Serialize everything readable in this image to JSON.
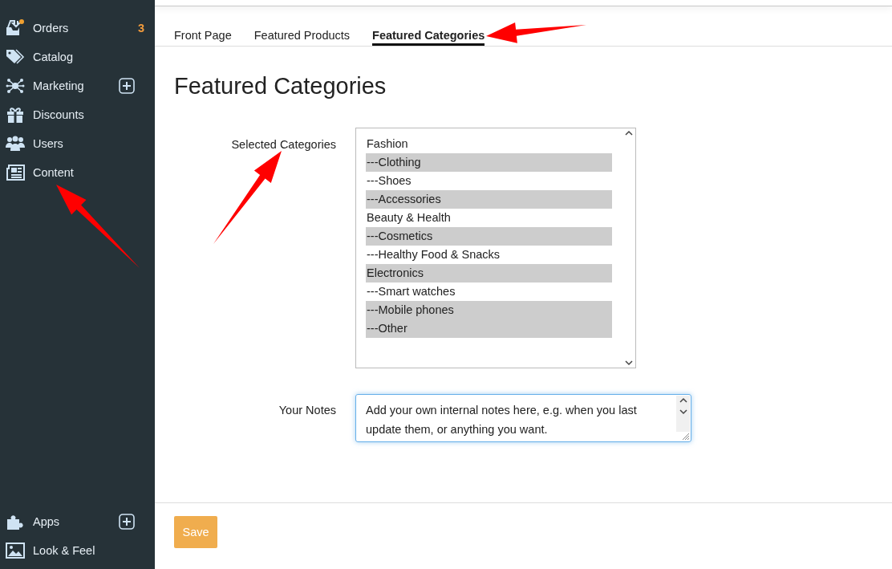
{
  "sidebar": {
    "items": [
      {
        "label": "Orders",
        "badge": "3",
        "add_button": false
      },
      {
        "label": "Catalog",
        "add_button": false
      },
      {
        "label": "Marketing",
        "add_button": true
      },
      {
        "label": "Discounts",
        "add_button": false
      },
      {
        "label": "Users",
        "add_button": false
      },
      {
        "label": "Content",
        "add_button": false
      }
    ],
    "bottom_items": [
      {
        "label": "Apps",
        "add_button": true
      },
      {
        "label": "Look & Feel",
        "add_button": false
      }
    ]
  },
  "tabs": [
    {
      "label": "Front Page",
      "selected": false
    },
    {
      "label": "Featured Products",
      "selected": false
    },
    {
      "label": "Featured Categories",
      "selected": true
    }
  ],
  "heading": "Featured Categories",
  "categories_field": {
    "label": "Selected Categories",
    "options": [
      {
        "label": "Fashion",
        "selected": false
      },
      {
        "label": "---Clothing",
        "selected": true
      },
      {
        "label": "---Shoes",
        "selected": false
      },
      {
        "label": "---Accessories",
        "selected": true
      },
      {
        "label": "Beauty & Health",
        "selected": false
      },
      {
        "label": "---Cosmetics",
        "selected": true
      },
      {
        "label": "---Healthy Food & Snacks",
        "selected": false
      },
      {
        "label": "Electronics",
        "selected": true
      },
      {
        "label": "---Smart watches",
        "selected": false
      },
      {
        "label": "---Mobile phones",
        "selected": true
      },
      {
        "label": "---Other",
        "selected": true
      }
    ]
  },
  "notes_field": {
    "label": "Your Notes",
    "value": "Add your own internal notes here, e.g. when you last update them, or anything you want."
  },
  "save_button": "Save"
}
